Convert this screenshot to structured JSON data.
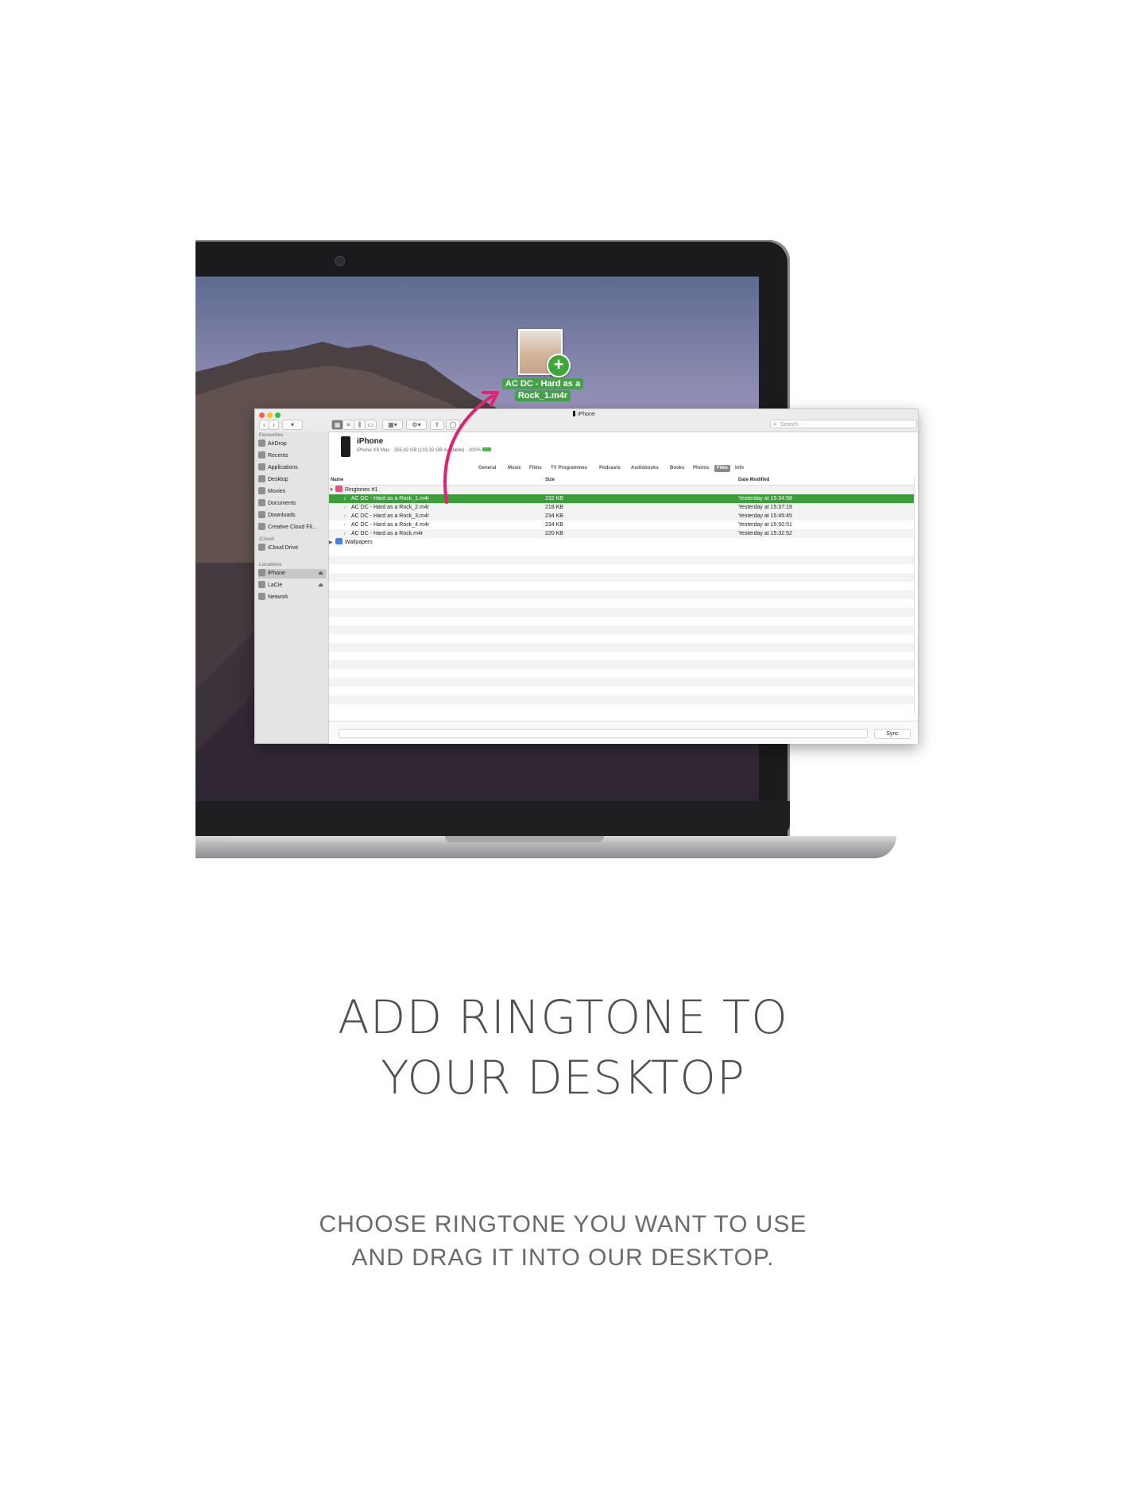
{
  "drag": {
    "label_line1": "AC DC - Hard as a",
    "label_line2": "Rock_1.m4r",
    "plus": "+"
  },
  "window": {
    "title": "iPhone",
    "search_placeholder": "Search"
  },
  "sidebar": {
    "favourites_heading": "Favourites",
    "favourites": [
      {
        "label": "AirDrop",
        "icon": "airdrop-icon"
      },
      {
        "label": "Recents",
        "icon": "clock-icon"
      },
      {
        "label": "Applications",
        "icon": "applications-icon"
      },
      {
        "label": "Desktop",
        "icon": "desktop-icon"
      },
      {
        "label": "Movies",
        "icon": "movies-icon"
      },
      {
        "label": "Documents",
        "icon": "document-icon"
      },
      {
        "label": "Downloads",
        "icon": "download-icon"
      },
      {
        "label": "Creative Cloud Fil...",
        "icon": "cloud-icon"
      }
    ],
    "icloud_heading": "iCloud",
    "icloud": [
      {
        "label": "iCloud Drive",
        "icon": "icloud-icon"
      }
    ],
    "locations_heading": "Locations",
    "locations": [
      {
        "label": "iPhone",
        "icon": "phone-icon",
        "eject": "⏏",
        "selected": true
      },
      {
        "label": "LaCie",
        "icon": "drive-icon",
        "eject": "⏏"
      },
      {
        "label": "Network",
        "icon": "network-icon"
      }
    ]
  },
  "device": {
    "name": "iPhone",
    "info": "iPhone XS Max · 255,92 GB (133,32 GB Available) · 100%"
  },
  "tabs": [
    {
      "label": "General"
    },
    {
      "label": "Music"
    },
    {
      "label": "Films"
    },
    {
      "label": "TV Programmes"
    },
    {
      "label": "Podcasts"
    },
    {
      "label": "Audiobooks"
    },
    {
      "label": "Books"
    },
    {
      "label": "Photos"
    },
    {
      "label": "Files",
      "active": true
    },
    {
      "label": "Info"
    }
  ],
  "columns": {
    "name": "Name",
    "size": "Size",
    "date": "Date Modified"
  },
  "files": {
    "folder1": {
      "name": "Ringtones #1",
      "arrow": "▼"
    },
    "items": [
      {
        "name": "AC DC - Hard as a Rock_1.m4r",
        "size": "232 KB",
        "date": "Yesterday at 15:34:58",
        "selected": true
      },
      {
        "name": "AC DC - Hard as a Rock_2.m4r",
        "size": "218 KB",
        "date": "Yesterday at 15:37:19"
      },
      {
        "name": "AC DC - Hard as a Rock_3.m4r",
        "size": "234 KB",
        "date": "Yesterday at 15:45:45"
      },
      {
        "name": "AC DC - Hard as a Rock_4.m4r",
        "size": "234 KB",
        "date": "Yesterday at 15:50:51"
      },
      {
        "name": "AC DC - Hard as a Rock.m4r",
        "size": "220 KB",
        "date": "Yesterday at 15:32:52"
      }
    ],
    "folder2": {
      "name": "Wallpapers",
      "arrow": "▶"
    }
  },
  "sync_label": "Sync",
  "headline": {
    "line1": "ADD RINGTONE TO",
    "line2": "YOUR DESKTOP"
  },
  "subline": {
    "line1": "CHOOSE RINGTONE YOU WANT TO USE",
    "line2": "AND DRAG IT INTO OUR DESKTOP."
  },
  "colors": {
    "accent_green": "#43a347",
    "arrow_pink": "#e0226f"
  }
}
